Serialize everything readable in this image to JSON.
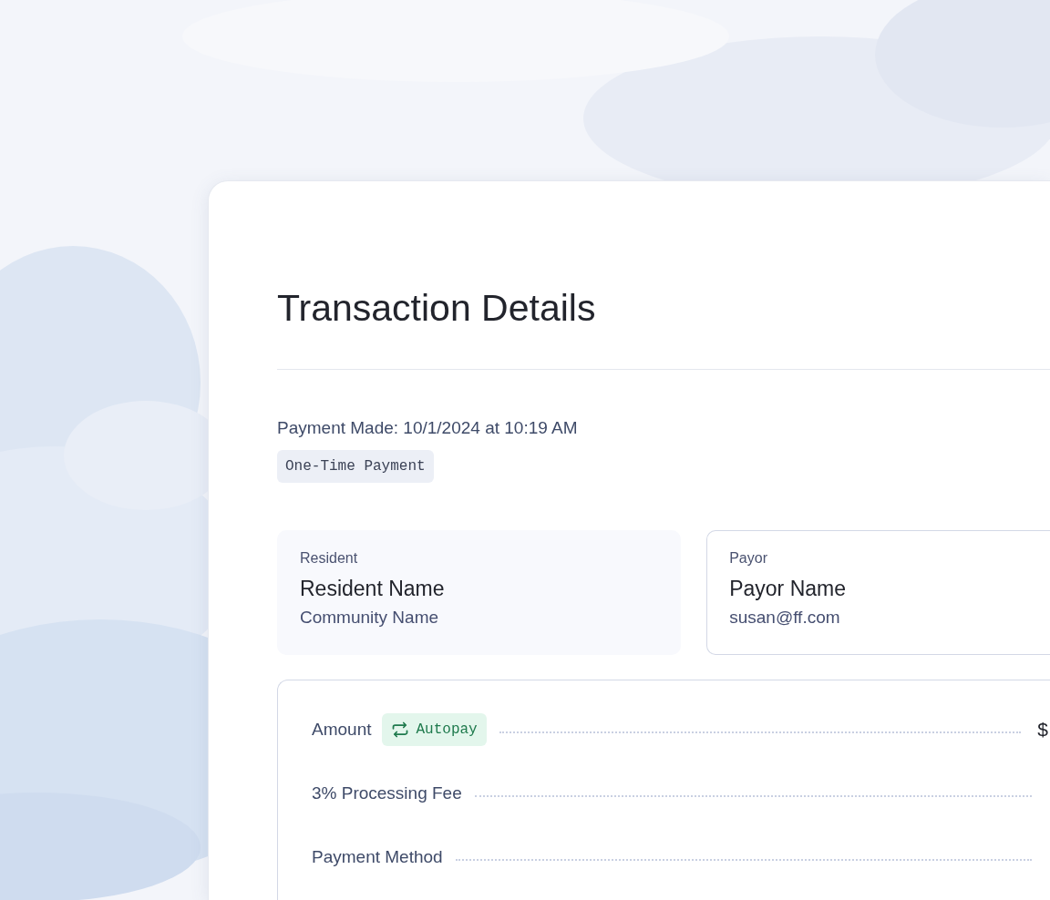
{
  "details": {
    "title": "Transaction Details",
    "payment_made": "Payment Made: 10/1/2024 at 10:19 AM",
    "tag": "One-Time Payment",
    "parties": [
      {
        "label": "Resident",
        "name": "Resident Name",
        "detail": "Community Name",
        "selected": false
      },
      {
        "label": "Payor",
        "name": "Payor Name",
        "detail": "susan@ff.com",
        "selected": true
      }
    ],
    "lines": [
      {
        "label": "Amount",
        "badge": "Autopay",
        "value": "$"
      },
      {
        "label": "3% Processing Fee"
      },
      {
        "label": "Payment Method"
      }
    ]
  }
}
